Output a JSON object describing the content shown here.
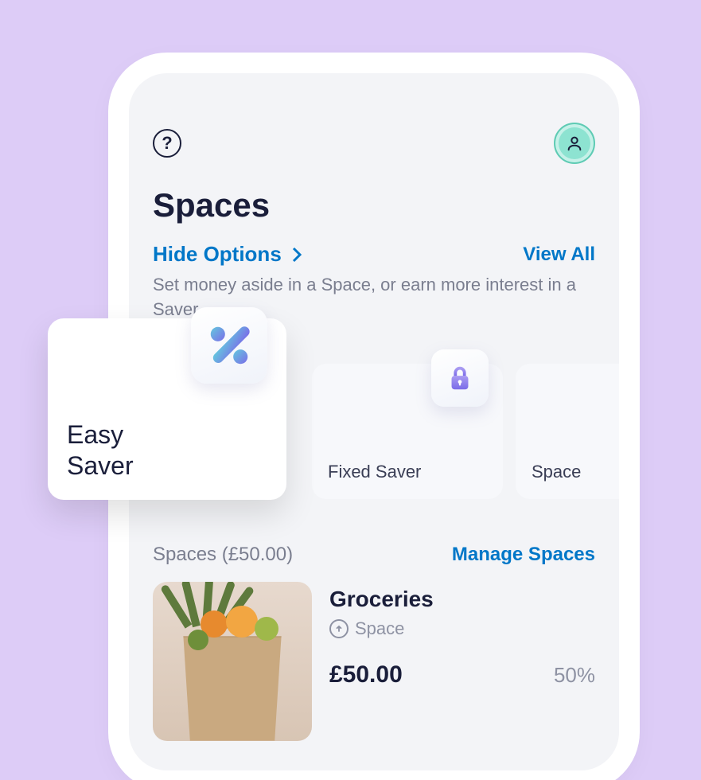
{
  "header": {
    "help_icon": "question-mark",
    "profile_icon": "person"
  },
  "page": {
    "title": "Spaces",
    "hide_options_label": "Hide Options",
    "view_all_label": "View All",
    "subtitle": "Set money aside in a Space, or earn more interest in a Saver."
  },
  "option_cards": {
    "easy_saver": "Easy Saver",
    "fixed_saver": "Fixed Saver",
    "space": "Space"
  },
  "spaces_list": {
    "header_label": "Spaces (£50.00)",
    "manage_label": "Manage Spaces",
    "items": [
      {
        "name": "Groceries",
        "type_label": "Space",
        "amount": "£50.00",
        "progress": "50%"
      }
    ]
  }
}
